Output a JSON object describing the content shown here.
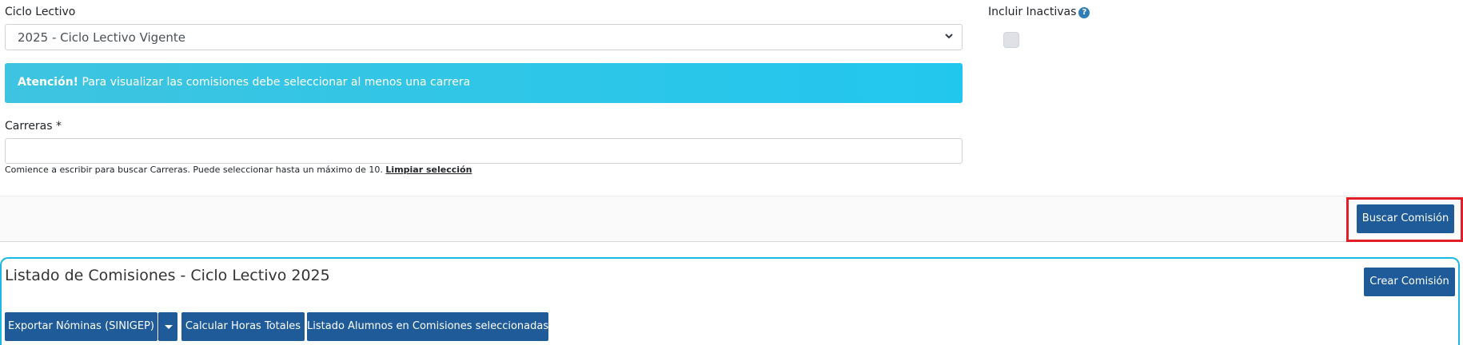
{
  "filters": {
    "ciclo_label": "Ciclo Lectivo",
    "ciclo_value": "2025 - Ciclo Lectivo Vigente",
    "inactivas_label": "Incluir Inactivas",
    "help_glyph": "?"
  },
  "alert": {
    "strong": "Atención!",
    "message": " Para visualizar las comisiones debe seleccionar al menos una carrera"
  },
  "carreras": {
    "label": "Carreras *",
    "value": "",
    "help": "Comience a escribir para buscar Carreras. Puede seleccionar hasta un máximo de 10. ",
    "clear_link": "Limpiar selección"
  },
  "actions": {
    "search_button": "Buscar Comisión"
  },
  "listado": {
    "title": "Listado de Comisiones - Ciclo Lectivo 2025",
    "create_button": "Crear Comisión",
    "export_button": "Exportar Nóminas (SINIGEP)",
    "calc_button": "Calcular Horas Totales",
    "students_button": "Listado Alumnos en Comisiones seleccionadas"
  },
  "colors": {
    "primary": "#1f5b99",
    "info": "#22c7ee",
    "highlight": "#e01f26",
    "panel_border": "#1bb8e4"
  }
}
